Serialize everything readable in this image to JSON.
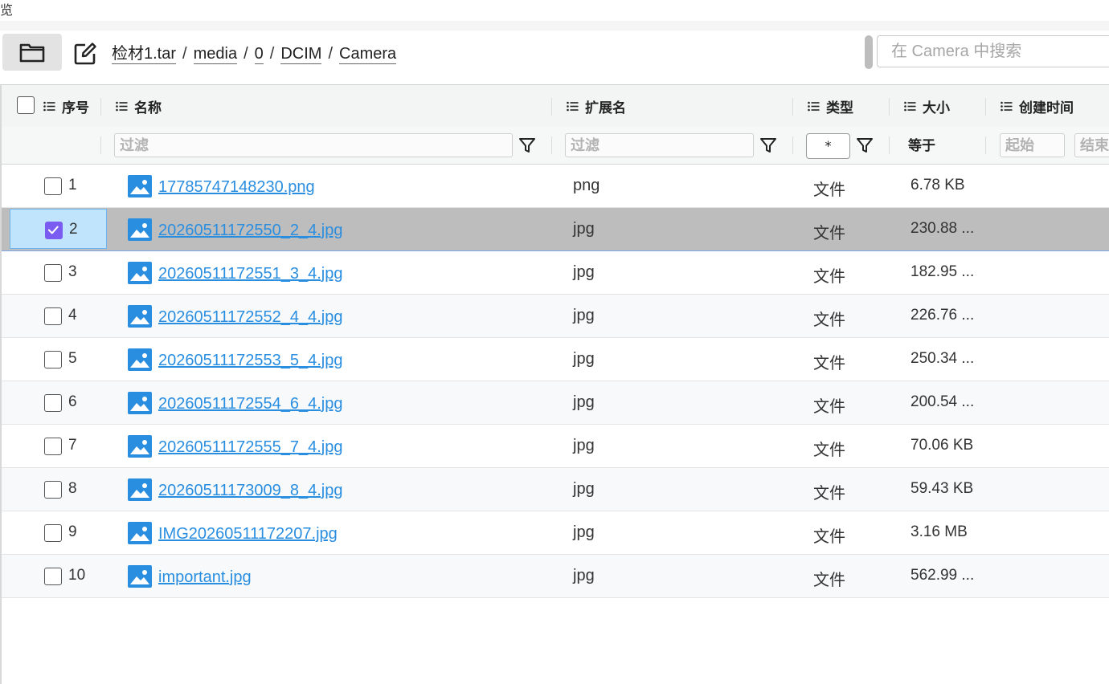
{
  "window": {
    "title_fragment": "览"
  },
  "toolbar": {
    "breadcrumb": [
      "检材1.tar",
      "media",
      "0",
      "DCIM",
      "Camera"
    ],
    "breadcrumb_sep": "/",
    "search_placeholder": "在 Camera 中搜索",
    "icons": {
      "folder": "folder-icon",
      "edit": "edit-icon"
    }
  },
  "grid": {
    "columns": {
      "index": "序号",
      "name": "名称",
      "ext": "扩展名",
      "type": "类型",
      "size": "大小",
      "created": "创建时间"
    },
    "filters": {
      "name_placeholder": "过滤",
      "ext_placeholder": "过滤",
      "type_value": "*",
      "size_op": "等于",
      "created_start_placeholder": "起始",
      "created_end_placeholder": "结束"
    },
    "rows": [
      {
        "index": "1",
        "name": "17785747148230.png",
        "ext": "png",
        "type": "文件",
        "size": "6.78 KB",
        "checked": false,
        "selected": false
      },
      {
        "index": "2",
        "name": "20260511172550_2_4.jpg",
        "ext": "jpg",
        "type": "文件",
        "size": "230.88 ...",
        "checked": true,
        "selected": true
      },
      {
        "index": "3",
        "name": "20260511172551_3_4.jpg",
        "ext": "jpg",
        "type": "文件",
        "size": "182.95 ...",
        "checked": false,
        "selected": false
      },
      {
        "index": "4",
        "name": "20260511172552_4_4.jpg",
        "ext": "jpg",
        "type": "文件",
        "size": "226.76 ...",
        "checked": false,
        "selected": false
      },
      {
        "index": "5",
        "name": "20260511172553_5_4.jpg",
        "ext": "jpg",
        "type": "文件",
        "size": "250.34 ...",
        "checked": false,
        "selected": false
      },
      {
        "index": "6",
        "name": "20260511172554_6_4.jpg",
        "ext": "jpg",
        "type": "文件",
        "size": "200.54 ...",
        "checked": false,
        "selected": false
      },
      {
        "index": "7",
        "name": "20260511172555_7_4.jpg",
        "ext": "jpg",
        "type": "文件",
        "size": "70.06 KB",
        "checked": false,
        "selected": false
      },
      {
        "index": "8",
        "name": "20260511173009_8_4.jpg",
        "ext": "jpg",
        "type": "文件",
        "size": "59.43 KB",
        "checked": false,
        "selected": false
      },
      {
        "index": "9",
        "name": "IMG20260511172207.jpg",
        "ext": "jpg",
        "type": "文件",
        "size": "3.16 MB",
        "checked": false,
        "selected": false
      },
      {
        "index": "10",
        "name": "important.jpg",
        "ext": "jpg",
        "type": "文件",
        "size": "562.99 ...",
        "checked": false,
        "selected": false
      }
    ]
  },
  "colors": {
    "link": "#2a8ee0",
    "selected_row": "#bdbdbd",
    "selected_cell": "#bfe4fb",
    "checkbox_on": "#7a5cf0",
    "image_icon": "#2a8ee0"
  }
}
